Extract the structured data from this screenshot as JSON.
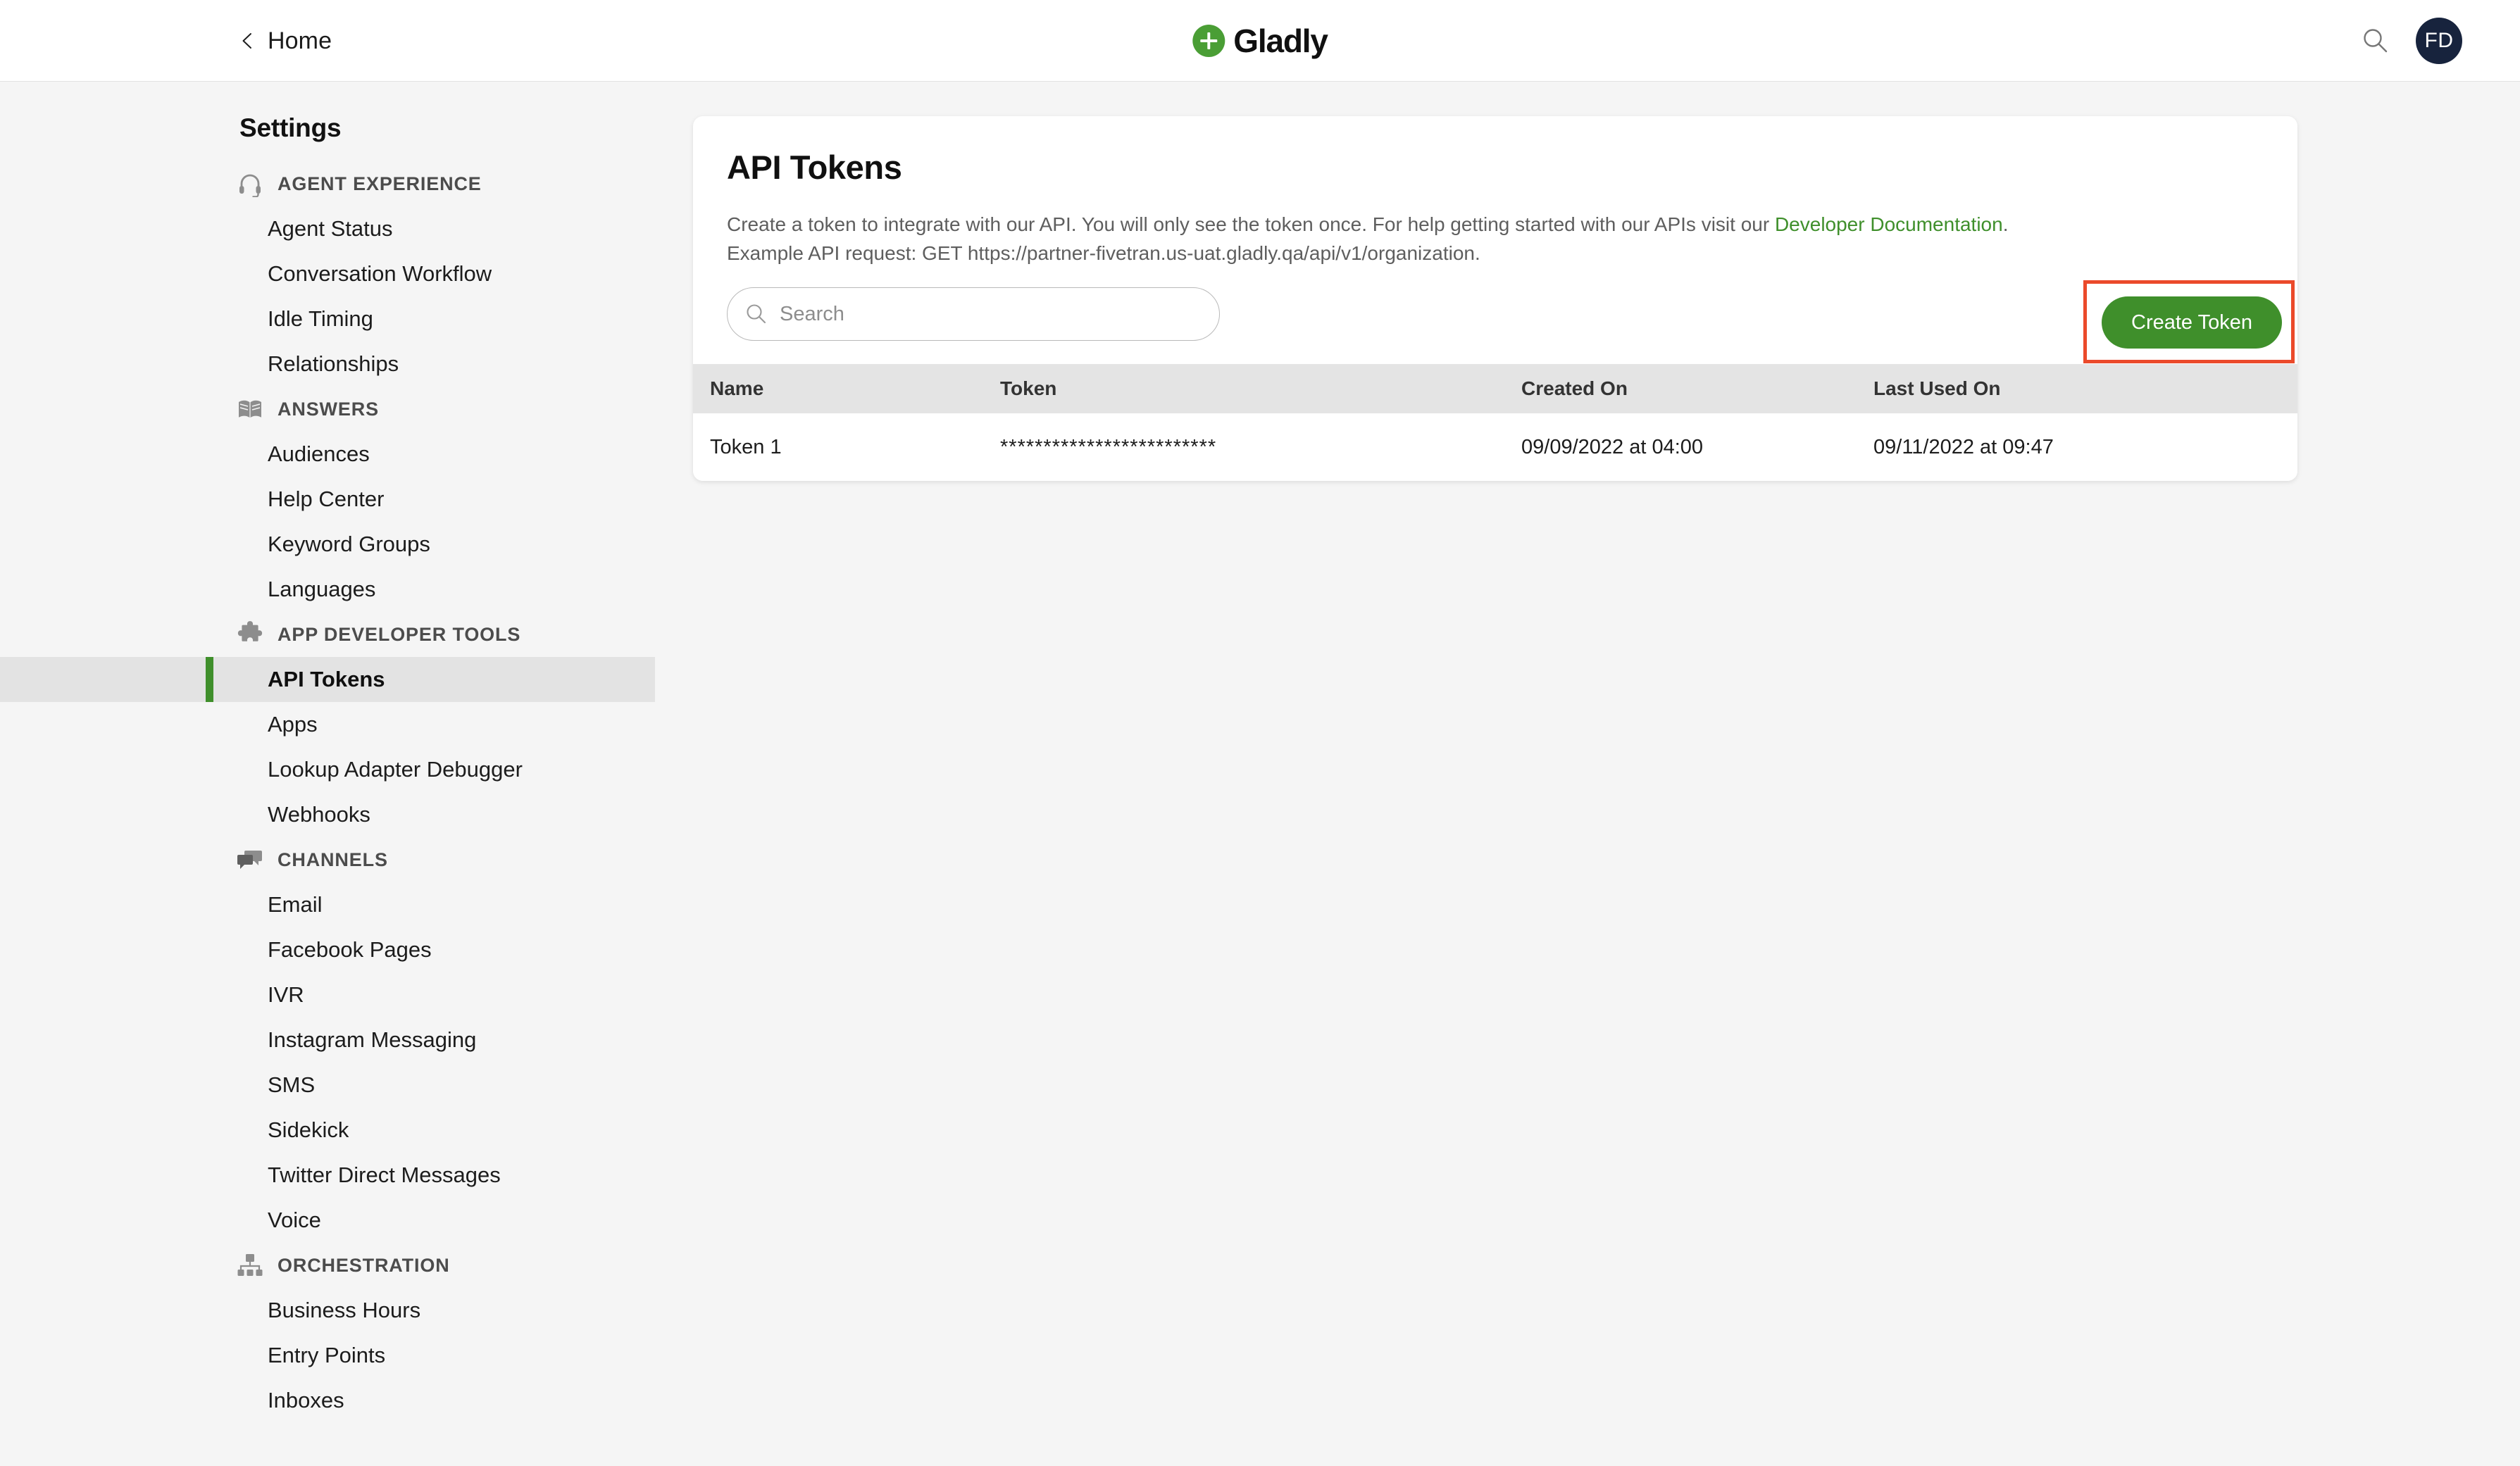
{
  "header": {
    "back_label": "Home",
    "back_icon": "chevron-left-icon",
    "brand": "Gladly",
    "brand_mark_color": "#4a9e35",
    "search_icon": "search-icon",
    "avatar_initials": "FD",
    "avatar_color": "#17233d"
  },
  "sidebar": {
    "title": "Settings",
    "active_item": "API Tokens",
    "active_accent": "#3f8f2b",
    "groups": [
      {
        "label": "AGENT EXPERIENCE",
        "icon": "headset-icon",
        "items": [
          {
            "label": "Agent Status"
          },
          {
            "label": "Conversation Workflow"
          },
          {
            "label": "Idle Timing"
          },
          {
            "label": "Relationships"
          }
        ]
      },
      {
        "label": "ANSWERS",
        "icon": "book-icon",
        "items": [
          {
            "label": "Audiences"
          },
          {
            "label": "Help Center"
          },
          {
            "label": "Keyword Groups"
          },
          {
            "label": "Languages"
          }
        ]
      },
      {
        "label": "APP DEVELOPER TOOLS",
        "icon": "puzzle-icon",
        "items": [
          {
            "label": "API Tokens"
          },
          {
            "label": "Apps"
          },
          {
            "label": "Lookup Adapter Debugger"
          },
          {
            "label": "Webhooks"
          }
        ]
      },
      {
        "label": "CHANNELS",
        "icon": "chat-bubbles-icon",
        "items": [
          {
            "label": "Email"
          },
          {
            "label": "Facebook Pages"
          },
          {
            "label": "IVR"
          },
          {
            "label": "Instagram Messaging"
          },
          {
            "label": "SMS"
          },
          {
            "label": "Sidekick"
          },
          {
            "label": "Twitter Direct Messages"
          },
          {
            "label": "Voice"
          }
        ]
      },
      {
        "label": "ORCHESTRATION",
        "icon": "sitemap-icon",
        "items": [
          {
            "label": "Business Hours"
          },
          {
            "label": "Entry Points"
          },
          {
            "label": "Inboxes"
          }
        ]
      }
    ]
  },
  "main": {
    "title": "API Tokens",
    "description_before_link": "Create a token to integrate with our API. You will only see the token once. For help getting started with our APIs visit our ",
    "description_link": "Developer Documentation",
    "description_after_link": ".",
    "example_request": "Example API request: GET https://partner-fivetran.us-uat.gladly.qa/api/v1/organization.",
    "link_color": "#3f8f2b",
    "search": {
      "placeholder": "Search",
      "value": "",
      "icon": "search-icon"
    },
    "create_token_label": "Create Token",
    "create_token_color": "#3f8f2b",
    "highlight_color": "#eb4a2b",
    "table": {
      "columns": [
        "Name",
        "Token",
        "Created On",
        "Last Used On"
      ],
      "rows": [
        {
          "name": "Token 1",
          "token": "*************************",
          "created_on": "09/09/2022 at 04:00",
          "last_used_on": "09/11/2022 at 09:47"
        }
      ]
    }
  }
}
